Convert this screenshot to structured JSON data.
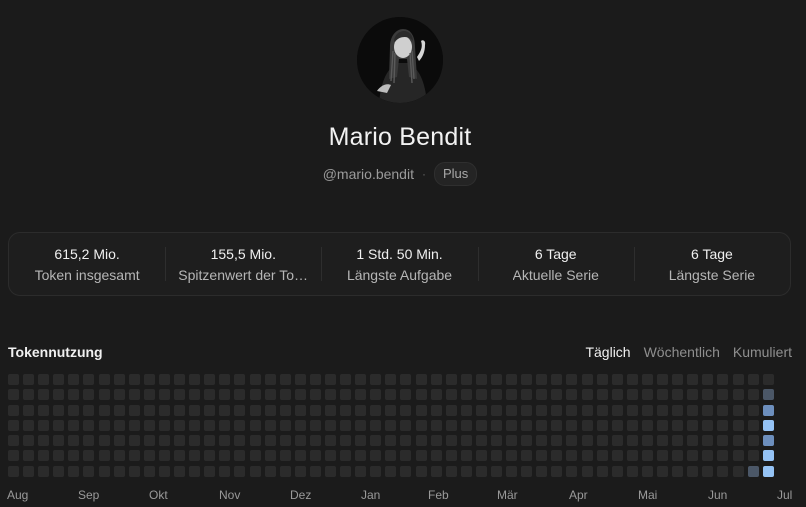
{
  "profile": {
    "name": "Mario Bendit",
    "handle": "@mario.bendit",
    "plan": "Plus"
  },
  "stats": [
    {
      "value": "615,2 Mio.",
      "label": "Token insgesamt"
    },
    {
      "value": "155,5 Mio.",
      "label": "Spitzenwert der Tokennutzung"
    },
    {
      "value": "1 Std. 50 Min.",
      "label": "Längste Aufgabe"
    },
    {
      "value": "6 Tage",
      "label": "Aktuelle Serie"
    },
    {
      "value": "6 Tage",
      "label": "Längste Serie"
    }
  ],
  "usage": {
    "title": "Tokennutzung",
    "tabs": [
      {
        "label": "Täglich",
        "active": true
      },
      {
        "label": "Wöchentlich",
        "active": false
      },
      {
        "label": "Kumuliert",
        "active": false
      }
    ],
    "months": [
      "Aug",
      "Sep",
      "Okt",
      "Nov",
      "Dez",
      "Jan",
      "Feb",
      "Mär",
      "Apr",
      "Mai",
      "Jun",
      "Jul"
    ],
    "weeks": 51,
    "active_days": [
      {
        "week": 49,
        "day": 6,
        "level": 1
      },
      {
        "week": 50,
        "day": 1,
        "level": 1
      },
      {
        "week": 50,
        "day": 2,
        "level": 2
      },
      {
        "week": 50,
        "day": 3,
        "level": 3
      },
      {
        "week": 50,
        "day": 4,
        "level": 2
      },
      {
        "week": 50,
        "day": 5,
        "level": 3
      },
      {
        "week": 50,
        "day": 6,
        "level": 3
      }
    ]
  }
}
